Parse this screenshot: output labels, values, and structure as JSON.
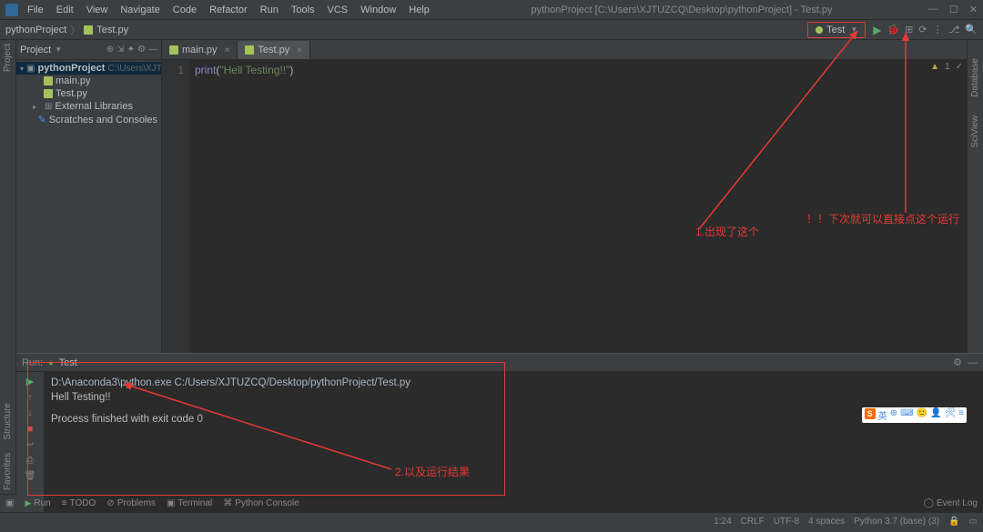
{
  "menubar": [
    "File",
    "Edit",
    "View",
    "Navigate",
    "Code",
    "Refactor",
    "Run",
    "Tools",
    "VCS",
    "Window",
    "Help"
  ],
  "window_title": "pythonProject [C:\\Users\\XJTUZCQ\\Desktop\\pythonProject] - Test.py",
  "breadcrumb": {
    "project": "pythonProject",
    "file": "Test.py"
  },
  "run_config": {
    "name": "Test"
  },
  "project_panel": {
    "title": "Project",
    "root": {
      "name": "pythonProject",
      "path": "C:\\Users\\XJTUZCQ\\Deskto"
    },
    "files": [
      "main.py",
      "Test.py"
    ],
    "external": "External Libraries",
    "scratches": "Scratches and Consoles"
  },
  "tabs": [
    {
      "name": "main.py",
      "active": false
    },
    {
      "name": "Test.py",
      "active": true
    }
  ],
  "editor": {
    "line_num": "1",
    "fn": "print",
    "lparen": "(",
    "str": "\"Hell Testing!!\"",
    "rparen": ")"
  },
  "editor_status": {
    "warnings": "1",
    "checkmark": "✓"
  },
  "run_panel": {
    "label": "Run:",
    "tab": "Test",
    "command": "D:\\Anaconda3\\python.exe C:/Users/XJTUZCQ/Desktop/pythonProject/Test.py",
    "output": "Hell Testing!!",
    "exit": "Process finished with exit code 0"
  },
  "bottom_bar": {
    "run": "Run",
    "todo": "TODO",
    "problems": "Problems",
    "terminal": "Terminal",
    "console": "Python Console"
  },
  "status_bar": {
    "event_log": "Event Log",
    "pos": "1:24",
    "line_end": "CRLF",
    "encoding": "UTF-8",
    "indent": "4 spaces",
    "interpreter": "Python 3.7 (base) (3)"
  },
  "side_labels": {
    "project": "Project",
    "structure": "Structure",
    "favorites": "Favorites",
    "database": "Database",
    "sciview": "SciView"
  },
  "annotations": {
    "a1": "1.出现了这个",
    "a2": "2.以及运行结果",
    "a3": "！！下次就可以直接点这个运行"
  },
  "ime": {
    "lang": "英"
  }
}
